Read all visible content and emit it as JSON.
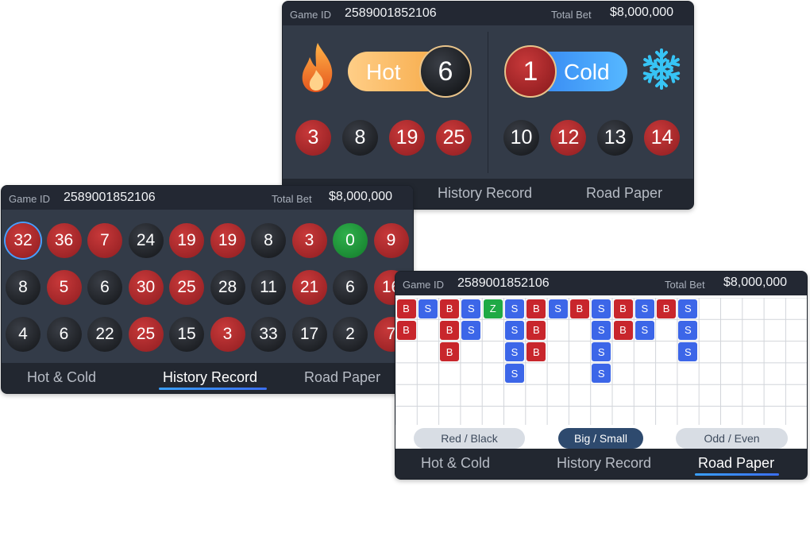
{
  "header": {
    "game_id_label": "Game ID",
    "game_id": "2589001852106",
    "total_bet_label": "Total Bet",
    "total_bet": "$8,000,000"
  },
  "tabs": {
    "hot_cold": "Hot & Cold",
    "history": "History Record",
    "road": "Road Paper"
  },
  "hot_cold": {
    "hot_label": "Hot",
    "hot_count": "6",
    "cold_label": "Cold",
    "cold_count": "1",
    "hot_numbers": [
      {
        "n": "3",
        "c": "r"
      },
      {
        "n": "8",
        "c": "b"
      },
      {
        "n": "19",
        "c": "r"
      },
      {
        "n": "25",
        "c": "r"
      }
    ],
    "cold_numbers": [
      {
        "n": "10",
        "c": "b"
      },
      {
        "n": "12",
        "c": "r"
      },
      {
        "n": "13",
        "c": "b"
      },
      {
        "n": "14",
        "c": "r"
      }
    ],
    "icons": [
      "fire-icon",
      "snowflake-icon"
    ]
  },
  "history": {
    "rows": [
      [
        {
          "n": "32",
          "c": "r"
        },
        {
          "n": "36",
          "c": "r"
        },
        {
          "n": "7",
          "c": "r"
        },
        {
          "n": "24",
          "c": "b"
        },
        {
          "n": "19",
          "c": "r"
        },
        {
          "n": "19",
          "c": "r"
        },
        {
          "n": "8",
          "c": "b"
        },
        {
          "n": "3",
          "c": "r"
        },
        {
          "n": "0",
          "c": "g"
        },
        {
          "n": "9",
          "c": "r"
        }
      ],
      [
        {
          "n": "8",
          "c": "b"
        },
        {
          "n": "5",
          "c": "r"
        },
        {
          "n": "6",
          "c": "b"
        },
        {
          "n": "30",
          "c": "r"
        },
        {
          "n": "25",
          "c": "r"
        },
        {
          "n": "28",
          "c": "b"
        },
        {
          "n": "11",
          "c": "b"
        },
        {
          "n": "21",
          "c": "r"
        },
        {
          "n": "6",
          "c": "b"
        },
        {
          "n": "16",
          "c": "r"
        }
      ],
      [
        {
          "n": "4",
          "c": "b"
        },
        {
          "n": "6",
          "c": "b"
        },
        {
          "n": "22",
          "c": "b"
        },
        {
          "n": "25",
          "c": "r"
        },
        {
          "n": "15",
          "c": "b"
        },
        {
          "n": "3",
          "c": "r"
        },
        {
          "n": "33",
          "c": "b"
        },
        {
          "n": "17",
          "c": "b"
        },
        {
          "n": "2",
          "c": "b"
        },
        {
          "n": "7",
          "c": "r"
        }
      ]
    ]
  },
  "road_paper": {
    "columns": [
      [
        "B",
        "B"
      ],
      [
        "S"
      ],
      [
        "B",
        "B",
        "B"
      ],
      [
        "S",
        "S"
      ],
      [
        "Z"
      ],
      [
        "S",
        "S",
        "S",
        "S"
      ],
      [
        "B",
        "B",
        "B"
      ],
      [
        "S"
      ],
      [
        "B"
      ],
      [
        "S",
        "S",
        "S",
        "S"
      ],
      [
        "B",
        "B"
      ],
      [
        "S",
        "S"
      ],
      [
        "B"
      ],
      [
        "S",
        "S",
        "S"
      ]
    ],
    "buttons": [
      "Red / Black",
      "Big / Small",
      "Odd / Even"
    ],
    "active_button": "Big / Small"
  },
  "colors": {
    "red": "#c8262c",
    "black": "#121417",
    "green": "#1fa945",
    "blue_accent": "#3b6ff0",
    "hot_orange": "#f5a623",
    "cold_blue": "#2f8cff"
  }
}
